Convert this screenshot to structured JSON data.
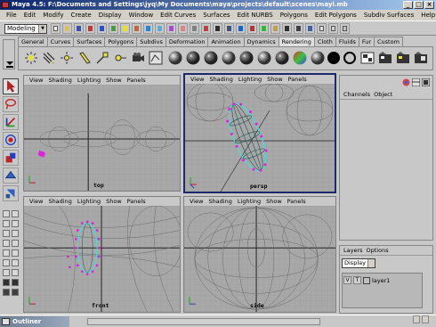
{
  "window": {
    "title": "Maya 4.5: F:\\Documents and Settings\\jyq\\My Documents\\maya\\projects\\default\\scenes\\mayi.mb",
    "minimize": "_",
    "maximize": "□",
    "close": "×"
  },
  "menubar": [
    "File",
    "Edit",
    "Modify",
    "Create",
    "Display",
    "Window",
    "Edit Curves",
    "Surfaces",
    "Edit NURBS",
    "Polygons",
    "Edit Polygons",
    "Subdiv Surfaces",
    "Help"
  ],
  "statusline": {
    "mode": "Modeling"
  },
  "shelf": {
    "tabs": [
      "General",
      "Curves",
      "Surfaces",
      "Polygons",
      "Subdivs",
      "Deformation",
      "Animation",
      "Dynamics",
      "Rendering",
      "Cloth",
      "Fluids",
      "Fur",
      "Custom"
    ],
    "active_tab": "Rendering"
  },
  "viewports": {
    "menu": [
      "View",
      "Shading",
      "Lighting",
      "Show",
      "Panels"
    ],
    "top": {
      "camera": "top"
    },
    "persp": {
      "camera": "persp"
    },
    "front": {
      "camera": "front"
    },
    "side": {
      "camera": "side"
    }
  },
  "channelbox": {
    "menu": [
      "Channels",
      "Object"
    ]
  },
  "layers": {
    "menu": [
      "Layers",
      "Options"
    ],
    "display": "Display",
    "rows": [
      {
        "v": "V",
        "t": "T",
        "name": "layer1"
      }
    ]
  },
  "outliner": {
    "title": "Outliner"
  },
  "colors": {
    "viewport_bg": "#a8a8a8",
    "grid": "#909090",
    "active_border": "#1c2a6c",
    "wire": "#606060",
    "selected_wire": "#40e0e0",
    "cv_points": "#e020e0"
  }
}
